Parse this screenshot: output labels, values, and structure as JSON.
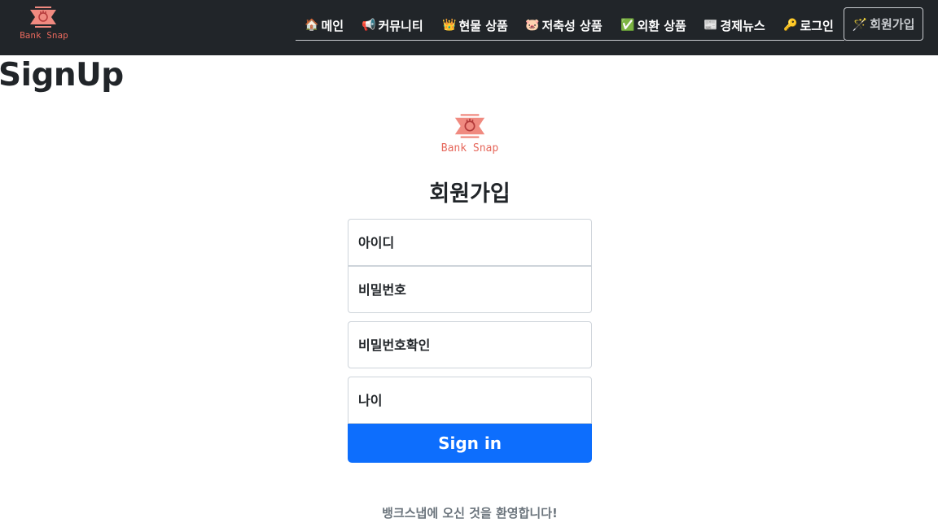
{
  "brand": {
    "logo_text": "Bank Snap",
    "logo_icon": "hand-flag-logo-icon",
    "logo_color": "#e6685c"
  },
  "nav": {
    "items": [
      {
        "icon": "🏠",
        "icon_name": "house-icon",
        "label": "메인"
      },
      {
        "icon": "📢",
        "icon_name": "megaphone-icon",
        "label": "커뮤니티"
      },
      {
        "icon": "👑",
        "icon_name": "crown-icon",
        "label": "현물 상품"
      },
      {
        "icon": "🐷",
        "icon_name": "pig-icon",
        "label": "저축성 상품"
      },
      {
        "icon": "✅",
        "icon_name": "check-icon",
        "label": "외환 상품"
      },
      {
        "icon": "📰",
        "icon_name": "newspaper-icon",
        "label": "경제뉴스"
      },
      {
        "icon": "🔑",
        "icon_name": "key-icon",
        "label": "로그인"
      }
    ],
    "active": {
      "icon": "🪄",
      "icon_name": "wand-icon",
      "label": "회원가입"
    },
    "background": "#212529"
  },
  "page": {
    "heading": "SignUp"
  },
  "form": {
    "logo_text": "Bank Snap",
    "title": "회원가입",
    "fields": {
      "username_placeholder": "아이디",
      "password_placeholder": "비밀번호",
      "password_confirm_placeholder": "비밀번호확인",
      "age_placeholder": "나이"
    },
    "submit_label": "Sign in",
    "submit_color": "#0d6efd"
  },
  "footer": {
    "welcome": "뱅크스냅에 오신 것을 환영합니다!"
  }
}
